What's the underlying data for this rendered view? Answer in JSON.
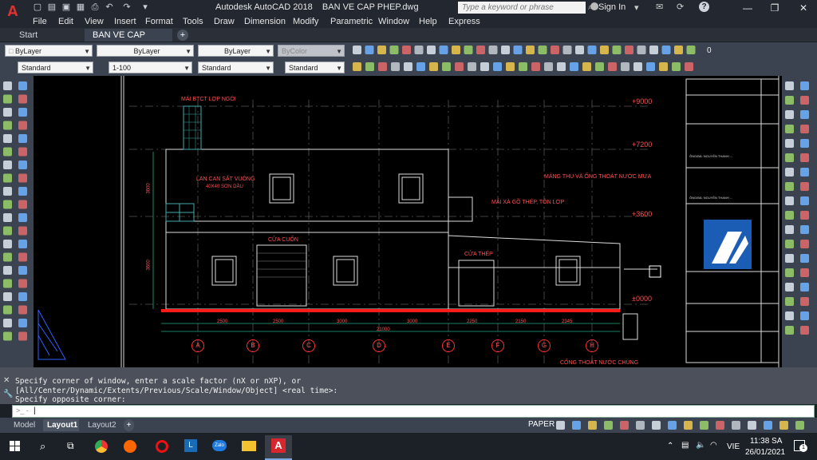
{
  "app": {
    "logo": "A",
    "title": "Autodesk AutoCAD 2018    BAN VE CAP PHEP.dwg",
    "search_placeholder": "Type a keyword or phrase",
    "sign_in": "Sign In",
    "accent": "#e03030"
  },
  "menu": [
    "File",
    "Edit",
    "View",
    "Insert",
    "Format",
    "Tools",
    "Draw",
    "Dimension",
    "Modify",
    "Parametric",
    "Window",
    "Help",
    "Express"
  ],
  "file_tabs": {
    "start": "Start",
    "active": "BAN VE CAP PHEP*",
    "close": "×",
    "add": "+"
  },
  "toolbar1": {
    "layer": "ByLayer",
    "linetype": "ByLayer",
    "lineweight": "ByLayer",
    "plotstyle": "ByColor",
    "layer_value": "0"
  },
  "toolbar2": {
    "text_style": "Standard",
    "scale": "1-100",
    "dim_style": "Standard",
    "table_style": "Standard"
  },
  "drawing": {
    "elev_labels": [
      "+9000",
      "+7200",
      "+3600",
      "±0000"
    ],
    "note_tile_roof": "MÁI BTCT LỢP NGÓI",
    "note_railing": "LAN CAN SẮT VUÔNG",
    "note_railing2": "40X40 SƠN DẦU",
    "note_gutter": "MÁNG THU VÀ ỐNG THOÁT NƯỚC MƯA",
    "note_roof": "MÁI XÀ GỒ THÉP, TÔN LỢP",
    "note_roller": "CỬA CUỐN",
    "note_steel_door": "CỬA THÉP",
    "note_drain": "CỐNG THOÁT NƯỚC CHUNG",
    "dims": [
      "2500",
      "2500",
      "3000",
      "3000",
      "2250",
      "2150",
      "2345"
    ],
    "total_dim": "21000",
    "axes": [
      "A",
      "B",
      "C",
      "D",
      "E",
      "F",
      "G",
      "H"
    ],
    "left_dims": [
      "3600",
      "3600"
    ],
    "titleblock": {
      "name1": "ÔNG/BÀ: NGUYỄN THANH ...",
      "name2": "ÔNG/BÀ: NGUYỄN THANH ...",
      "brand": "#1b5db5"
    }
  },
  "command": {
    "line1": "Specify corner of window, enter a scale factor (nX or nXP), or",
    "line2": "[All/Center/Dynamic/Extents/Previous/Scale/Window/Object] <real time>:",
    "line3": "Specify opposite corner:",
    "prompt": ">_ -",
    "input": "|"
  },
  "layout_tabs": [
    "Model",
    "Layout1",
    "Layout2"
  ],
  "layout_add": "+",
  "status": {
    "paper": "PAPER"
  },
  "taskbar": {
    "lang": "VIE",
    "time": "11:38 SA",
    "date": "26/01/2021",
    "notif": "1"
  }
}
